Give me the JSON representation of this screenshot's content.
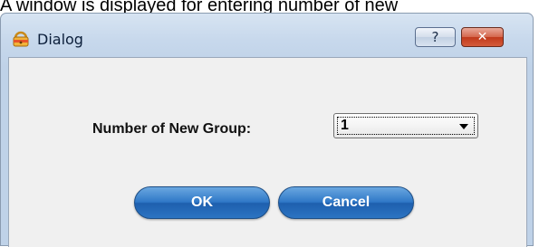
{
  "caption_fragment": "A window is displayed for entering number of new",
  "window": {
    "title": "Dialog",
    "app_icon": "warning-lock-icon",
    "help_glyph": "?",
    "close_glyph": "✕"
  },
  "form": {
    "number_label": "Number of New Group:",
    "number_value": "1"
  },
  "buttons": {
    "ok_label": "OK",
    "cancel_label": "Cancel"
  }
}
